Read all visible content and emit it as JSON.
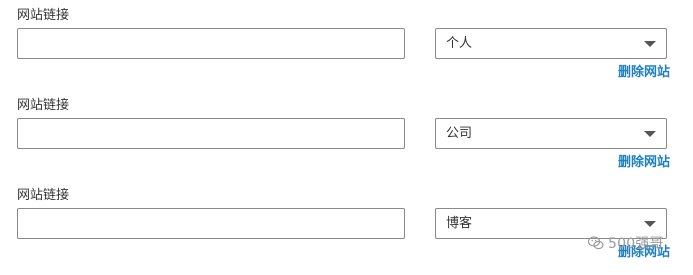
{
  "website_links": [
    {
      "label": "网站链接",
      "value": "",
      "type": "个人",
      "remove_label": "删除网站"
    },
    {
      "label": "网站链接",
      "value": "",
      "type": "公司",
      "remove_label": "删除网站"
    },
    {
      "label": "网站链接",
      "value": "",
      "type": "博客",
      "remove_label": "删除网站"
    }
  ],
  "watermark": {
    "text": "500强哥",
    "icon": "wechat-icon"
  },
  "colors": {
    "link": "#1f7fc1",
    "border": "#8a8a8a",
    "text": "#333333"
  }
}
